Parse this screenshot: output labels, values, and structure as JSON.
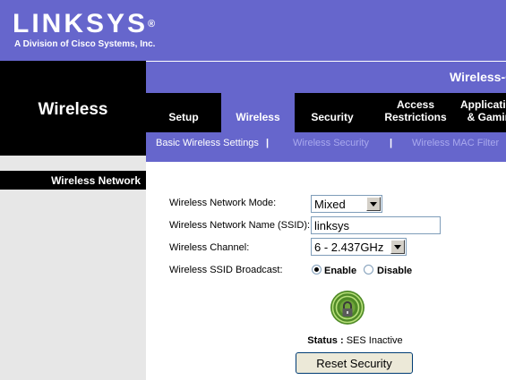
{
  "brand": {
    "logo": "LINKSYS",
    "logo_mark": "®",
    "subtitle": "A Division of Cisco Systems, Inc."
  },
  "section_title": "Wireless",
  "product_name": "Wireless-G",
  "tabs": [
    {
      "label": "Setup",
      "active": false
    },
    {
      "label": "Wireless",
      "active": true
    },
    {
      "label": "Security",
      "active": false
    },
    {
      "label": "Access Restrictions",
      "active": false
    },
    {
      "label": "Applications & Gaming",
      "active": false
    }
  ],
  "subtabs": [
    {
      "label": "Basic Wireless Settings",
      "active": true
    },
    {
      "label": "Wireless Security",
      "active": false
    },
    {
      "label": "Wireless MAC Filter",
      "active": false
    }
  ],
  "subtab_separator": "|",
  "left_label": "Wireless Network",
  "form": {
    "mode_label": "Wireless Network Mode:",
    "mode_value": "Mixed",
    "ssid_label": "Wireless Network Name (SSID):",
    "ssid_value": "linksys",
    "channel_label": "Wireless Channel:",
    "channel_value": "6 - 2.437GHz",
    "broadcast_label": "Wireless SSID Broadcast:",
    "broadcast_enable": "Enable",
    "broadcast_disable": "Disable",
    "broadcast_selected": "Enable"
  },
  "ses": {
    "status_label": "Status :",
    "status_value": "SES Inactive",
    "reset_button": "Reset Security"
  },
  "colors": {
    "brand": "#6666cc",
    "dark": "#000000",
    "subnav_inactive": "#a9a9ee",
    "panel_gray": "#e7e7e7",
    "ses_green": "#6fa33a"
  }
}
